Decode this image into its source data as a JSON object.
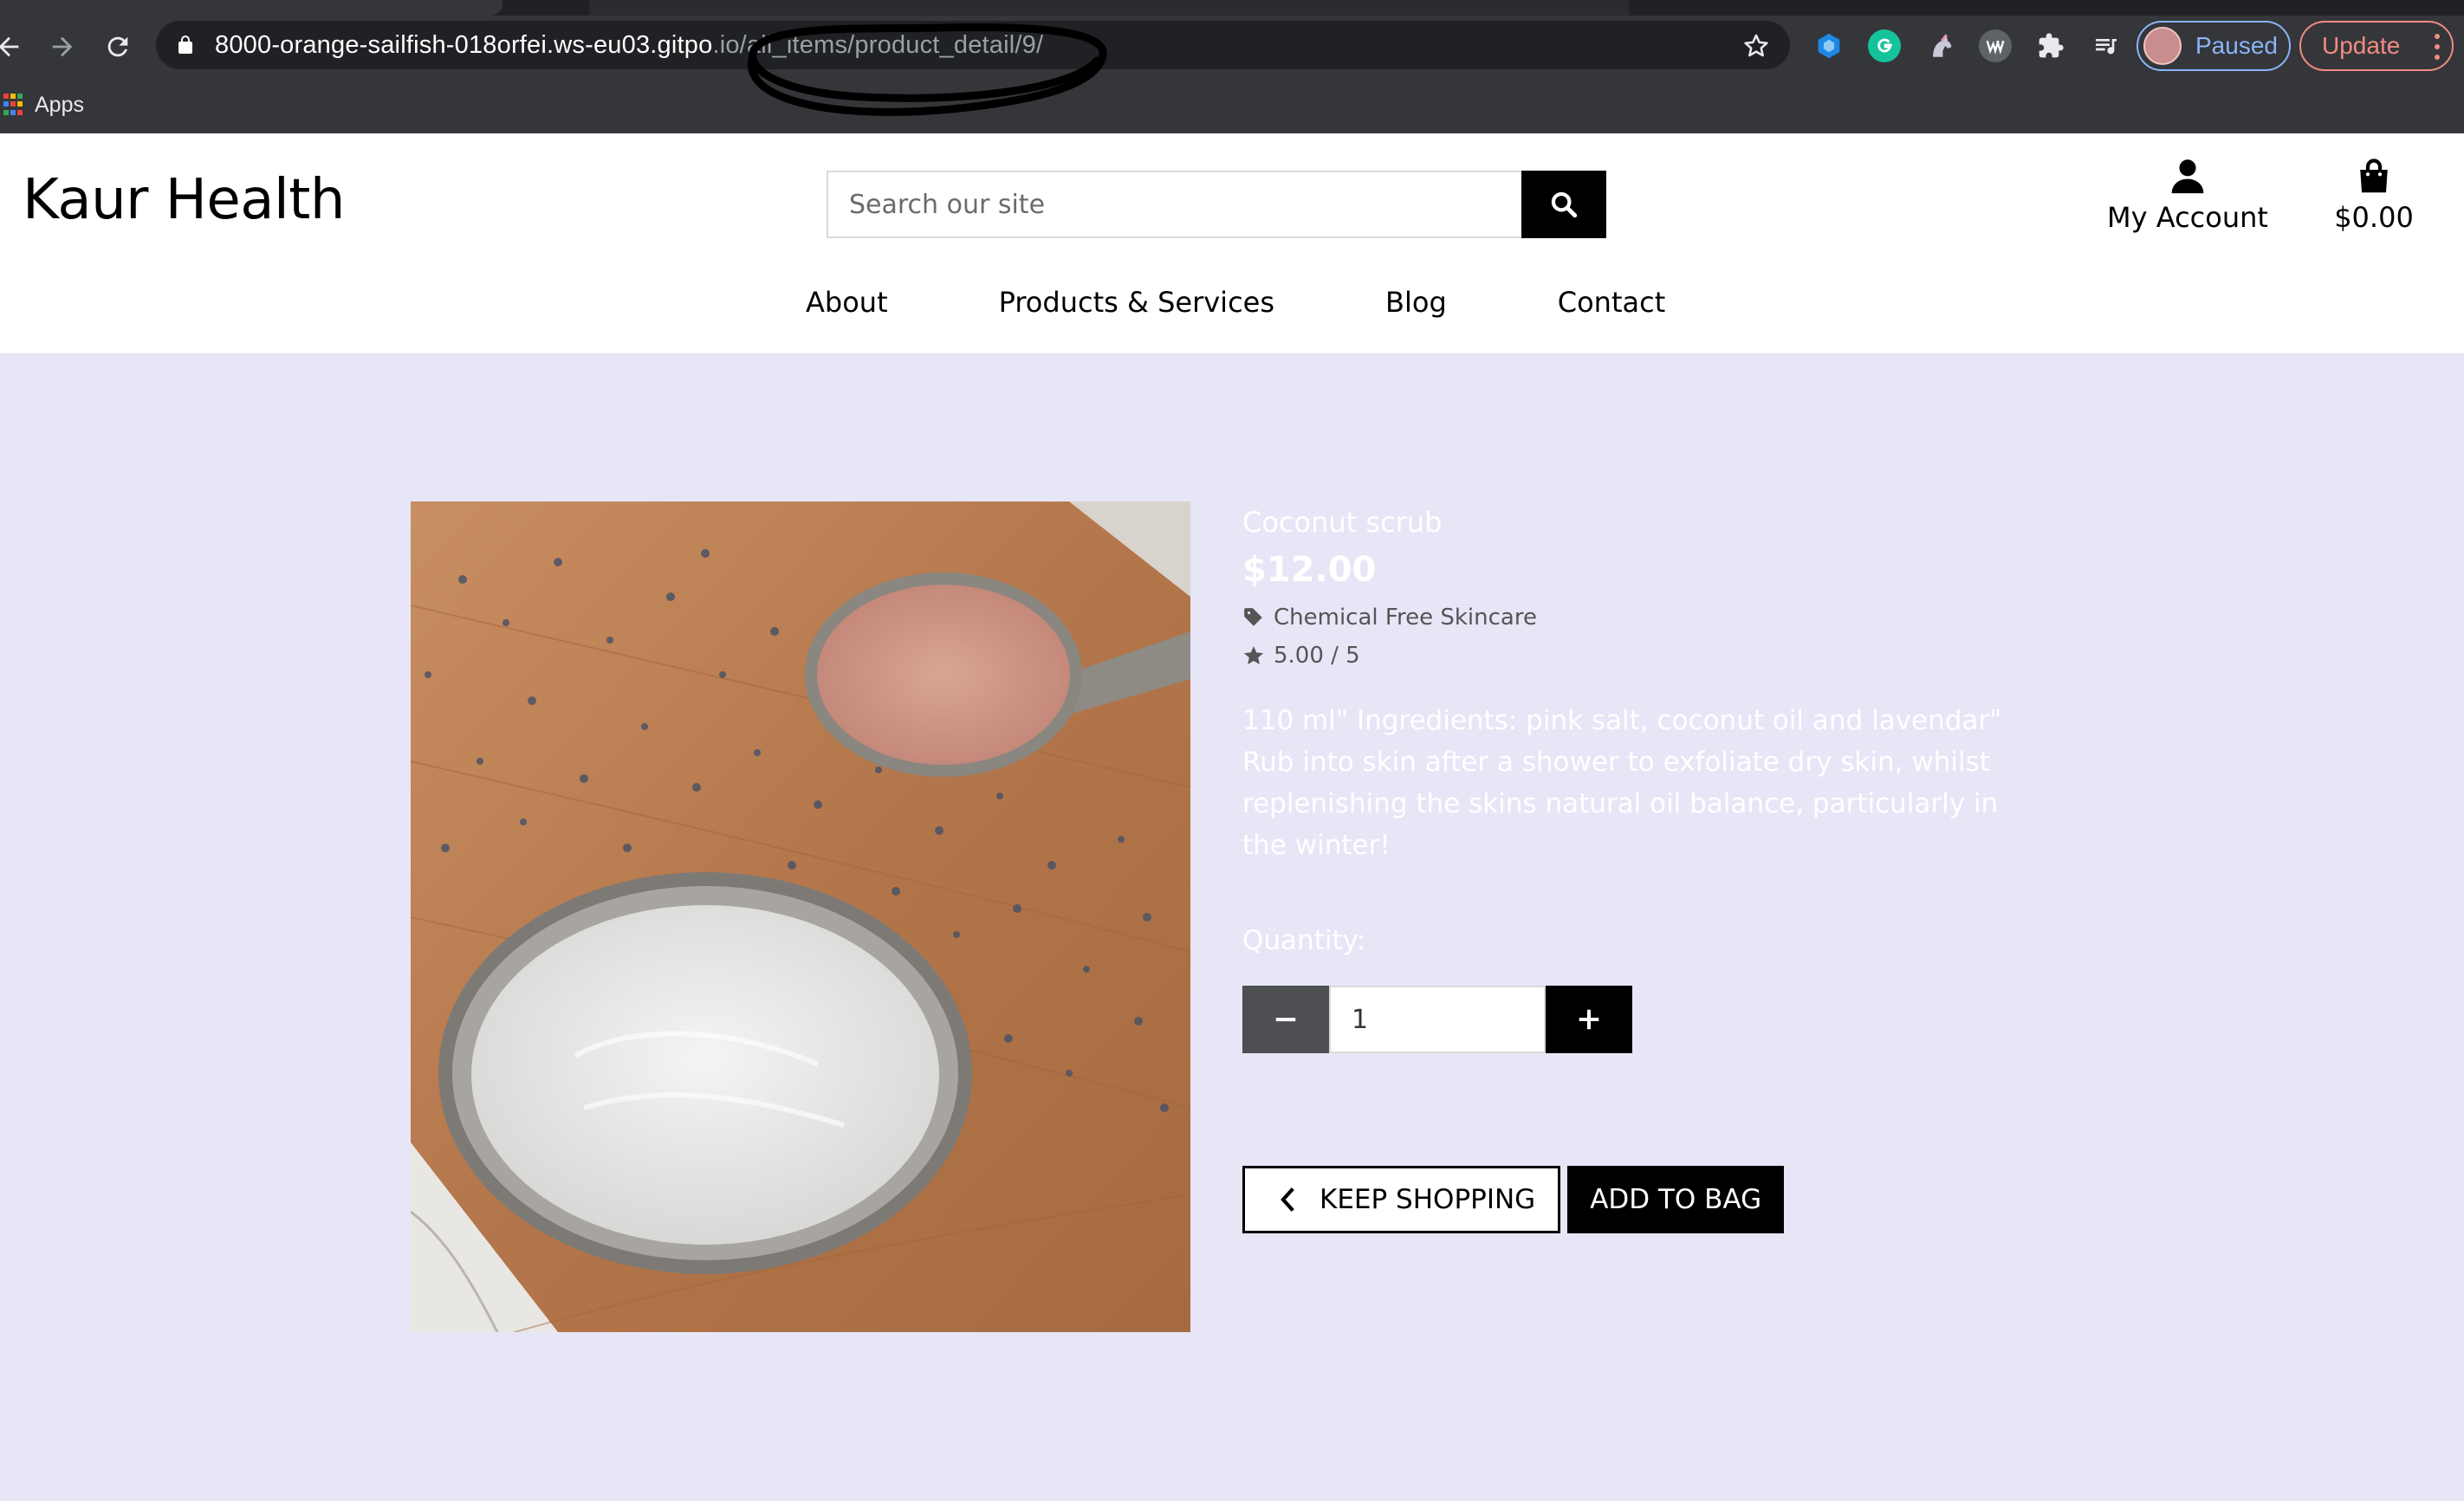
{
  "browser": {
    "url_host": "8000-orange-sailfish-018orfei.ws-eu03.gitpo",
    "url_path": ".io/all_items/product_detail/9/",
    "profile_label": "Paused",
    "update_label": "Update",
    "bookmarks": {
      "apps_label": "Apps"
    }
  },
  "site": {
    "brand": "Kaur Health",
    "search": {
      "placeholder": "Search our site"
    },
    "account_label": "My Account",
    "bag_total": "$0.00",
    "nav": [
      "About",
      "Products & Services",
      "Blog",
      "Contact"
    ]
  },
  "product": {
    "name": "Coconut scrub",
    "price": "$12.00",
    "category": "Chemical Free Skincare",
    "rating": "5.00 / 5",
    "description": "110 ml\" Ingredients: pink salt, coconut oil and lavendar\" Rub into skin after a shower to exfoliate dry skin, whilst replenishing the skins natural oil balance, particularly in the winter!",
    "quantity_label": "Quantity:",
    "quantity_value": "1",
    "keep_shopping_label": "KEEP SHOPPING",
    "add_to_bag_label": "ADD TO BAG"
  },
  "colors": {
    "page_bg": "#e6e6f7",
    "chrome_bg": "#35363a",
    "profile_accent": "#8ab4f8",
    "update_accent": "#f28b82"
  }
}
